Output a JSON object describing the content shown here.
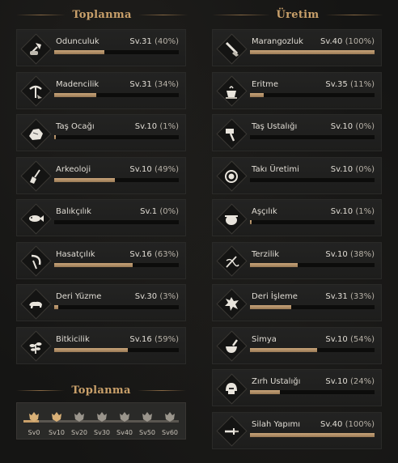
{
  "columns": {
    "gathering_title": "Toplanma",
    "crafting_title": "Üretim"
  },
  "gathering_skills": [
    {
      "name": "Odunculuk",
      "level": "Sv.31",
      "percent": "(40%)",
      "progress": 0.4,
      "icon": "axe-log-icon"
    },
    {
      "name": "Madencilik",
      "level": "Sv.31",
      "percent": "(34%)",
      "progress": 0.34,
      "icon": "pickaxe-icon"
    },
    {
      "name": "Taş Ocağı",
      "level": "Sv.10",
      "percent": "(1%)",
      "progress": 0.01,
      "icon": "stone-icon"
    },
    {
      "name": "Arkeoloji",
      "level": "Sv.10",
      "percent": "(49%)",
      "progress": 0.49,
      "icon": "shovel-icon"
    },
    {
      "name": "Balıkçılık",
      "level": "Sv.1",
      "percent": "(0%)",
      "progress": 0.0,
      "icon": "fish-icon"
    },
    {
      "name": "Hasatçılık",
      "level": "Sv.16",
      "percent": "(63%)",
      "progress": 0.63,
      "icon": "sickle-icon"
    },
    {
      "name": "Deri Yüzme",
      "level": "Sv.30",
      "percent": "(3%)",
      "progress": 0.03,
      "icon": "beast-icon"
    },
    {
      "name": "Bitkicilik",
      "level": "Sv.16",
      "percent": "(59%)",
      "progress": 0.59,
      "icon": "herb-icon"
    }
  ],
  "crafting_skills": [
    {
      "name": "Marangozluk",
      "level": "Sv.40",
      "percent": "(100%)",
      "progress": 1.0,
      "icon": "saw-icon"
    },
    {
      "name": "Eritme",
      "level": "Sv.35",
      "percent": "(11%)",
      "progress": 0.11,
      "icon": "crucible-icon"
    },
    {
      "name": "Taş Ustalığı",
      "level": "Sv.10",
      "percent": "(0%)",
      "progress": 0.0,
      "icon": "hammer-icon"
    },
    {
      "name": "Takı Üretimi",
      "level": "Sv.10",
      "percent": "(0%)",
      "progress": 0.0,
      "icon": "gem-icon"
    },
    {
      "name": "Aşçılık",
      "level": "Sv.10",
      "percent": "(1%)",
      "progress": 0.01,
      "icon": "cauldron-icon"
    },
    {
      "name": "Terzilik",
      "level": "Sv.10",
      "percent": "(38%)",
      "progress": 0.38,
      "icon": "needle-icon"
    },
    {
      "name": "Deri İşleme",
      "level": "Sv.31",
      "percent": "(33%)",
      "progress": 0.33,
      "icon": "hide-icon"
    },
    {
      "name": "Simya",
      "level": "Sv.10",
      "percent": "(54%)",
      "progress": 0.54,
      "icon": "mortar-icon"
    },
    {
      "name": "Zırh Ustalığı",
      "level": "Sv.10",
      "percent": "(24%)",
      "progress": 0.24,
      "icon": "helmet-icon"
    },
    {
      "name": "Silah Yapımı",
      "level": "Sv.40",
      "percent": "(100%)",
      "progress": 1.0,
      "icon": "sword-icon"
    }
  ],
  "tier_panel": {
    "title": "Toplanma",
    "tiers": [
      "Sv0",
      "Sv10",
      "Sv20",
      "Sv30",
      "Sv40",
      "Sv50",
      "Sv60"
    ],
    "unlocked_count": 2,
    "progress": 0.1
  },
  "colors": {
    "accent": "#c9a06a",
    "bar_fill": "#b89068",
    "panel": "#212120",
    "background": "#151514"
  }
}
